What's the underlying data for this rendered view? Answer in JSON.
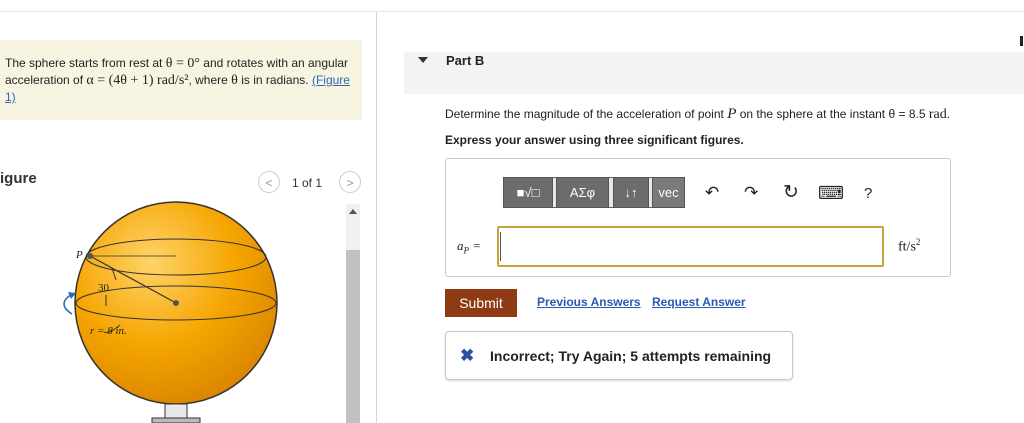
{
  "problem": {
    "text_1": "The sphere starts from rest at",
    "theta_eq": "θ = 0°",
    "text_2": "and rotates with an angular acceleration of",
    "alpha_expr": "α = (4θ + 1) rad/s²",
    "text_3": ", where",
    "theta": "θ",
    "text_4": "is in radians.",
    "figure_link": "(Figure 1)"
  },
  "figure": {
    "title": "igure",
    "pager_prev": "<",
    "pager_count": "1 of 1",
    "pager_next": ">",
    "label_p": "P",
    "label_angle": "30",
    "label_radius": "r = 8 in."
  },
  "part_b": {
    "title": "Part B",
    "question_1": "Determine the magnitude of the acceleration of point",
    "point": "P",
    "question_2": "on the sphere at the instant",
    "theta_value": "θ = 8.5",
    "question_unit": "rad",
    "question_end": ".",
    "instruction": "Express your answer using three significant figures."
  },
  "toolbar": {
    "templates": "■√□",
    "greek": "ΑΣφ",
    "arrows": "↓↑",
    "vec": "vec",
    "undo": "↶",
    "redo": "↷",
    "reset": "↻",
    "keyboard": "⌨",
    "help": "?"
  },
  "answer": {
    "label": "a",
    "label_sub": "P",
    "label_eq": " =",
    "value": "",
    "unit": "ft/s",
    "unit_sup": "2"
  },
  "actions": {
    "submit": "Submit",
    "previous_answers": "Previous Answers",
    "request_answer": "Request Answer"
  },
  "feedback": {
    "icon": "✖",
    "text": "Incorrect; Try Again; 5 attempts remaining"
  },
  "colors": {
    "sphere": "#f5a500",
    "submit": "#8e3a14",
    "link": "#2a5bb0",
    "input_border": "#c8a23a",
    "incorrect_icon": "#2b4ea8"
  }
}
